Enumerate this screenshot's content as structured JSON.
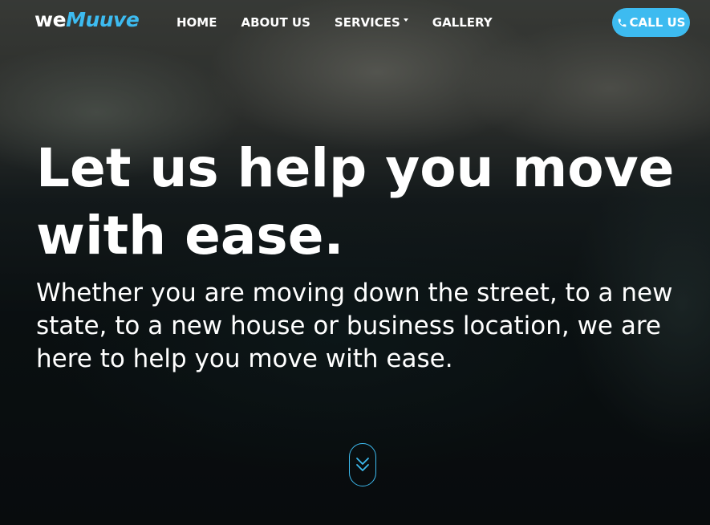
{
  "brand": {
    "part1": "we",
    "part2": "Muuve"
  },
  "nav": {
    "items": [
      {
        "label": "HOME"
      },
      {
        "label": "ABOUT US"
      },
      {
        "label": "SERVICES"
      },
      {
        "label": "GALLERY"
      }
    ],
    "call_label": "CALL US"
  },
  "hero": {
    "headline": "Let us help you move with ease.",
    "subtext": "Whether you are moving down the street, to a new state, to a new house or business location, we are here to help you move with ease."
  },
  "icons": {
    "phone": "phone-icon",
    "caret": "caret-down-icon",
    "scroll": "double-chevron-down-icon"
  },
  "colors": {
    "accent": "#3dbbf0",
    "text": "#ffffff"
  }
}
